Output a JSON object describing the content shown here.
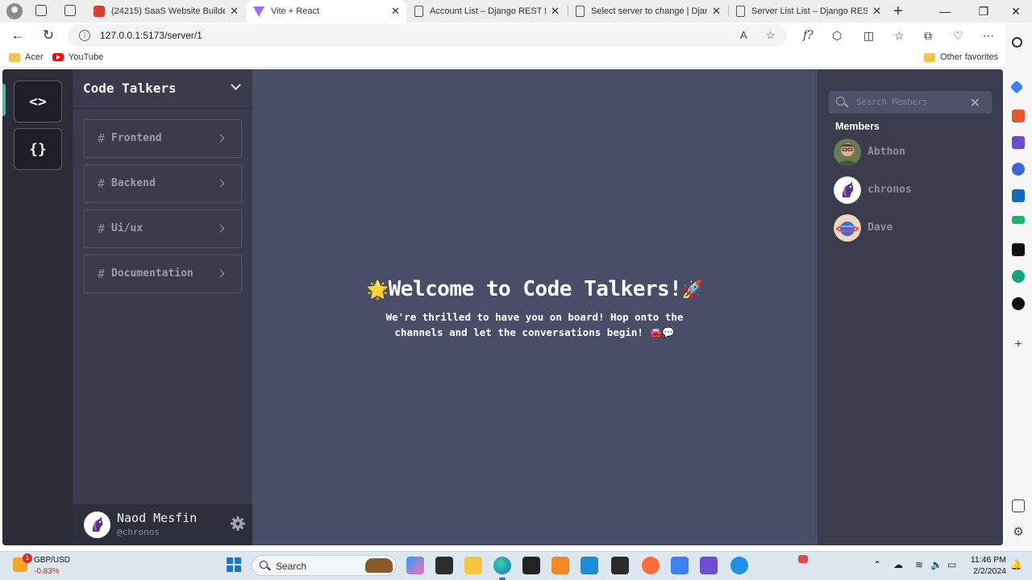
{
  "browser": {
    "tabs": [
      {
        "title": "(24215) SaaS Website Builder, Pr",
        "favicon": "youtube-favicon"
      },
      {
        "title": "Vite + React",
        "favicon": "vite-favicon"
      },
      {
        "title": "Account List – Django REST fram",
        "favicon": "document-favicon"
      },
      {
        "title": "Select server to change | Django",
        "favicon": "document-favicon"
      },
      {
        "title": "Server List List – Django REST fra",
        "favicon": "document-favicon"
      }
    ],
    "active_tab_index": 1,
    "url": "127.0.0.1:5173/server/1",
    "favorites": [
      {
        "label": "Acer",
        "icon": "folder-icon"
      },
      {
        "label": "YouTube",
        "icon": "youtube-icon"
      }
    ],
    "other_favorites": "Other favorites"
  },
  "app": {
    "server_rail": [
      {
        "glyph": "<>",
        "icon": "code-brackets-icon",
        "selected": true
      },
      {
        "glyph": "{}",
        "icon": "curly-braces-icon",
        "selected": false
      }
    ],
    "server_name": "Code Talkers",
    "channel_hash": "#",
    "channels": [
      {
        "name": "Frontend"
      },
      {
        "name": "Backend"
      },
      {
        "name": "Ui/ux"
      },
      {
        "name": "Documentation"
      }
    ],
    "user": {
      "display_name": "Naod Mesfin",
      "handle": "@chronos"
    },
    "welcome": {
      "emoji_left": "🌟",
      "title": "Welcome to Code Talkers!",
      "emoji_right": "🚀",
      "subtitle": "We're thrilled to have you on board! Hop onto the channels and let the conversations begin! 🚘💬"
    },
    "members_panel": {
      "search_placeholder": "Search Members",
      "heading": "Members",
      "members": [
        {
          "name": "Abthon",
          "avatar_color": "#6b7b5a"
        },
        {
          "name": "chronos",
          "avatar_color": "#ffffff"
        },
        {
          "name": "Dave",
          "avatar_color": "#f2d9b8"
        }
      ]
    },
    "colors": {
      "rail_bg": "#2b2c36",
      "channels_bg": "#3a3b4c",
      "main_bg": "#4a4d68",
      "members_bg": "#3b3d4e",
      "accent": "#4fb5a7"
    }
  },
  "taskbar": {
    "ticker_pair": "GBP/USD",
    "ticker_change": "-0.83%",
    "ticker_badge": "1",
    "search_label": "Search",
    "time": "11:46 PM",
    "date": "2/2/2024"
  }
}
